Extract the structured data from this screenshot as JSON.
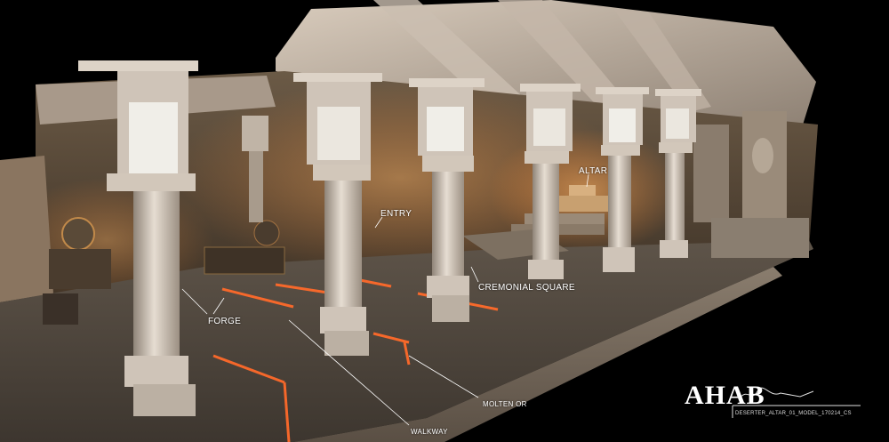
{
  "labels": {
    "entry": "ENTRY",
    "altar": "ALTAR",
    "forge": "FORGE",
    "cremonial_square": "CREMONIAL SQUARE",
    "molten_or": "MOLTEN OR",
    "walkway": "WALKWAY"
  },
  "watermark": {
    "logo_text": "AHAB",
    "model_code": "DESERTER_ALTAR_01_MODEL_170214_CS"
  },
  "colors": {
    "background": "#000000",
    "stone": "#b8aa9a",
    "molten_glow": "#ff6a2a",
    "label_text": "#ffffff"
  }
}
